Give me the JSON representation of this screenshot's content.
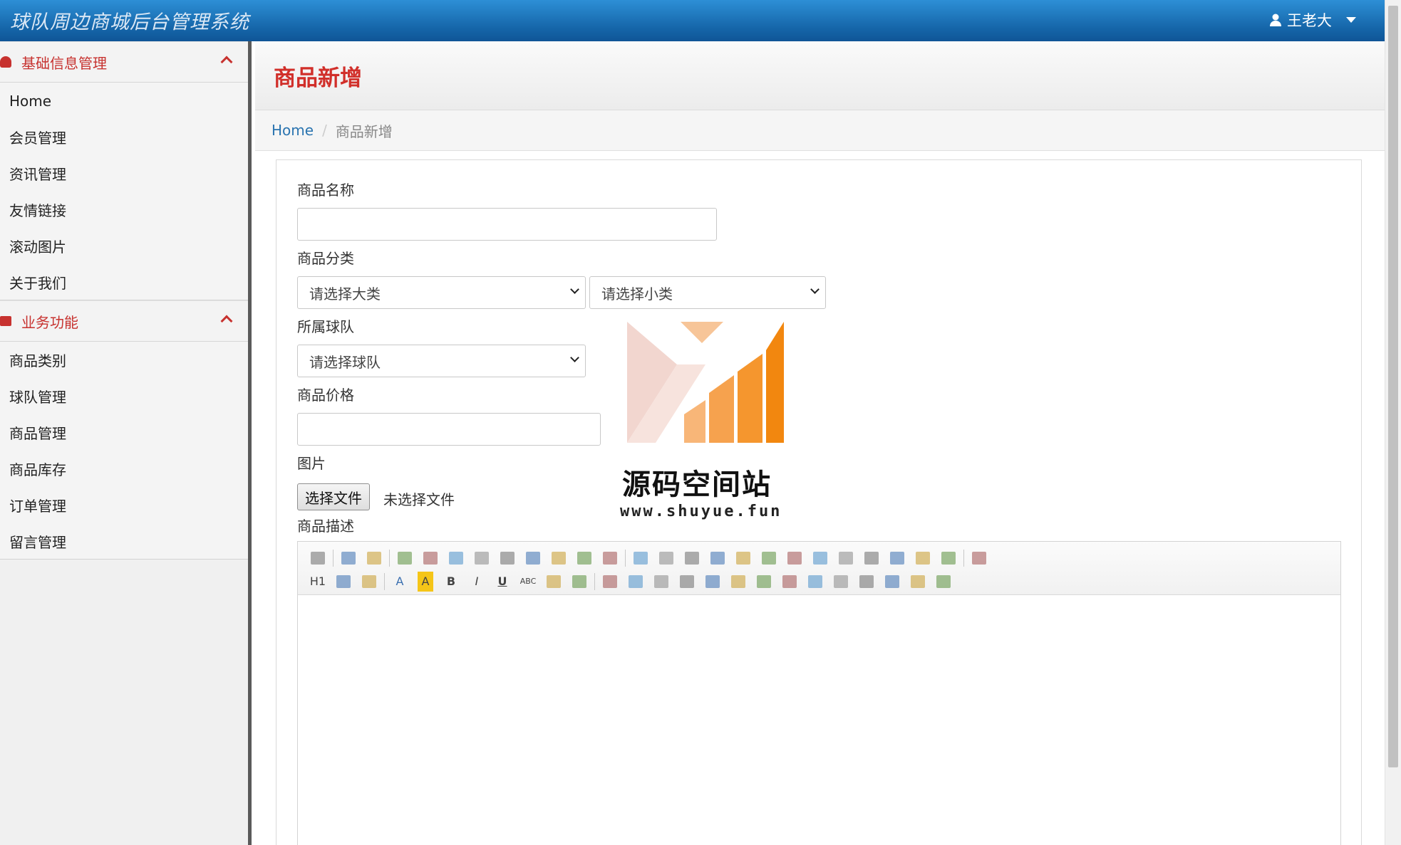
{
  "app": {
    "title": "球队周边商城后台管理系统"
  },
  "user": {
    "name": "王老大"
  },
  "sidebar": {
    "sections": [
      {
        "title": "基础信息管理",
        "items": [
          "Home",
          "会员管理",
          "资讯管理",
          "友情链接",
          "滚动图片",
          "关于我们"
        ]
      },
      {
        "title": "业务功能",
        "items": [
          "商品类别",
          "球队管理",
          "商品管理",
          "商品库存",
          "订单管理",
          "留言管理"
        ]
      }
    ]
  },
  "page": {
    "title": "商品新增"
  },
  "breadcrumb": {
    "home": "Home",
    "current": "商品新增"
  },
  "form": {
    "name_label": "商品名称",
    "category_label": "商品分类",
    "category_major": "请选择大类",
    "category_minor": "请选择小类",
    "team_label": "所属球队",
    "team_select": "请选择球队",
    "price_label": "商品价格",
    "image_label": "图片",
    "file_button": "选择文件",
    "file_status": "未选择文件",
    "desc_label": "商品描述"
  },
  "watermark": {
    "name": "源码空间站",
    "url": "www.shuyue.fun"
  },
  "editor_toolbar": {
    "row1": [
      "source-icon",
      "undo-icon",
      "redo-icon",
      "preview-icon",
      "print-icon",
      "template-icon",
      "code-icon",
      "cut-icon",
      "copy-icon",
      "paste-icon",
      "paste-text-icon",
      "paste-word-icon",
      "align-left-icon",
      "align-center-icon",
      "align-right-icon",
      "justify-icon",
      "ordered-list-icon",
      "unordered-list-icon",
      "indent-icon",
      "outdent-icon",
      "subscript-icon",
      "superscript-icon",
      "clear-format-icon",
      "select-all-icon",
      "cursor-icon",
      "fullscreen-icon"
    ],
    "row2": [
      "heading-icon",
      "font-family-icon",
      "font-size-icon",
      "font-color-icon",
      "highlight-icon",
      "bold-icon",
      "italic-icon",
      "underline-icon",
      "strikethrough-icon",
      "hr-icon",
      "eraser-icon",
      "image-icon",
      "multi-image-icon",
      "flash-icon",
      "media-icon",
      "attachment-icon",
      "table-icon",
      "insert-hr-icon",
      "emoticon-icon",
      "map-icon",
      "pagebreak-icon",
      "anchor-icon",
      "link-icon",
      "unlink-icon",
      "help-icon"
    ],
    "glyphs": {
      "heading": "H1",
      "bold": "B",
      "italic": "I",
      "underline": "U",
      "strike": "ABC",
      "font_color": "A",
      "highlight": "A"
    }
  }
}
